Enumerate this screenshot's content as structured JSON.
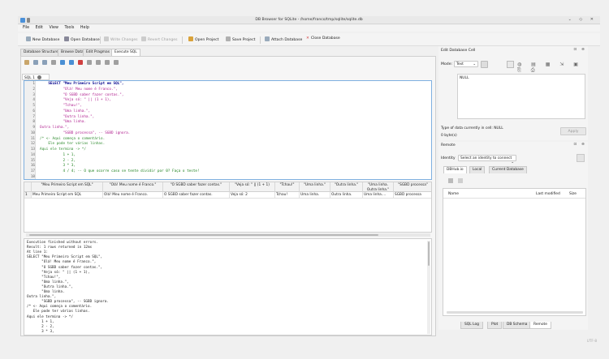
{
  "window": {
    "title": "DB Browser for SQLite - /home/franco/tmp/sqlite/sqlite.db"
  },
  "menu": [
    "File",
    "Edit",
    "View",
    "Tools",
    "Help"
  ],
  "toolbar": {
    "new_database": "New Database",
    "open_database": "Open Database",
    "write_changes": "Write Changes",
    "revert_changes": "Revert Changes",
    "open_project": "Open Project",
    "save_project": "Save Project",
    "attach_database": "Attach Database",
    "close_database": "Close Database"
  },
  "tabs": [
    "Database Structure",
    "Browse Data",
    "Edit Pragmas",
    "Execute SQL"
  ],
  "sql_tab": {
    "label": "SQL 1"
  },
  "editor": {
    "lines": [
      "    SELECT \"Meu Primeiro Script em SQL\",",
      "           \"Olá! Meu nome é Franco.\",",
      "           \"O SGBD saber fazer contas.\",",
      "           \"Veja só: \" || (1 + 1),",
      "           \"Tchau!\",",
      "           \"Uma linha.\",",
      "           \"Outra linha.\",",
      "           \"Uma linha.",
      "Outra linha.\",",
      "           \"SGBD processa\", -- SGBD ignora.",
      "/* <- Aqui começa o comentário.",
      "    Ele pode ter várias linhas.",
      "Aqui ele termina -> */",
      "           1 + 1,",
      "           2 - 2,",
      "           3 * 3,",
      "           4 / 4; -- O que ocorre caso se tente dividir por 0? Faça o teste!",
      ""
    ]
  },
  "results": {
    "headers": [
      "\"Meu Primeiro Script em SQL\"",
      "\"Olá! Meu nome é Franco.\"",
      "\"O SGBD saber fazer contas.\"",
      "\"Veja só: \" || (1 + 1)",
      "\"Tchau!\"",
      "\"Uma linha.\"",
      "\"Outra linha.\"",
      "\"Uma linha. Outra linha.\"",
      "\"SGBD processa\""
    ],
    "row_number": "1",
    "row": [
      "Meu Primeiro Script em SQL",
      "Olá! Meu nome é Franco.",
      "O SGBD saber fazer contas.",
      "Veja só: 2",
      "Tchau!",
      "Uma linha.",
      "Outra linha.",
      "Uma linha....",
      "SGBD processa"
    ]
  },
  "log": [
    "Execution finished without errors.",
    "Result: 1 rows returned in 12ms",
    "At line 1:",
    "SELECT \"Meu Primeiro Script em SQL\",",
    "       \"Olá! Meu nome é Franco.\",",
    "       \"O SGBD saber fazer contas.\",",
    "       \"Veja só: \" || (1 + 1),",
    "       \"Tchau!\",",
    "       \"Uma linha.\",",
    "       \"Outra linha.\",",
    "       \"Uma linha.",
    "Outra linha.\",",
    "       \"SGBD processa\", -- SGBD ignora.",
    "/* <- Aqui começa o comentário.",
    "   Ele pode ter várias linhas.",
    "Aqui ele termina -> */",
    "       1 + 1,",
    "       2 - 2,",
    "       3 * 3,"
  ],
  "edit_cell": {
    "title": "Edit Database Cell",
    "mode_label": "Mode:",
    "mode_value": "Text",
    "cell_value": "NULL",
    "type_info": "Type of data currently in cell: NULL",
    "size_info": "0 byte(s)",
    "apply": "Apply"
  },
  "remote": {
    "title": "Remote",
    "identity_label": "Identity",
    "identity_value": "Select an identity to connect",
    "tabs": [
      "DBHub.io",
      "Local",
      "Current Database"
    ],
    "columns": [
      "Name",
      "Last modified",
      "Size"
    ]
  },
  "bottom_tabs": [
    "SQL Log",
    "Plot",
    "DB Schema",
    "Remote"
  ],
  "status": {
    "encoding": "UTF-8"
  }
}
